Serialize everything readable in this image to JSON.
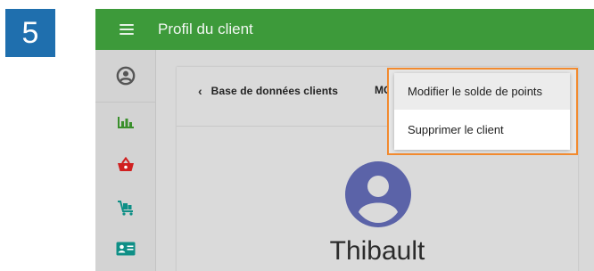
{
  "step": {
    "number": "5"
  },
  "app_bar": {
    "title": "Profil du client",
    "menu_icon": "hamburger-menu-icon"
  },
  "sidebar": {
    "items": [
      {
        "icon": "account-circle-icon"
      },
      {
        "icon": "bar-chart-icon"
      },
      {
        "icon": "shopping-basket-icon"
      },
      {
        "icon": "luggage-cart-icon"
      },
      {
        "icon": "id-card-icon"
      }
    ]
  },
  "card": {
    "back_label": "Base de données clients",
    "truncated_action": "MC",
    "customer_name": "Thibault"
  },
  "dropdown": {
    "items": [
      {
        "label": "Modifier le solde de points"
      },
      {
        "label": "Supprimer le client"
      }
    ]
  },
  "colors": {
    "app_bar": "#3d9a3a",
    "highlight": "#f28a2e",
    "step_badge": "#1f6fae",
    "avatar": "#5b63a8",
    "icon_green": "#3a8f2c",
    "icon_red": "#d02020",
    "icon_teal": "#0e8f86"
  }
}
